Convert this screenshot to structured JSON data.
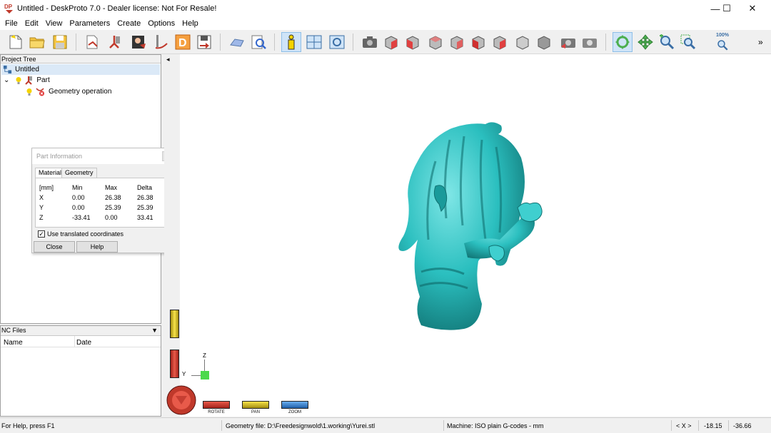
{
  "window": {
    "title": "Untitled - DeskProto 7.0 - Dealer license: Not For Resale!",
    "logo_text": "DP",
    "minimize": "—",
    "maximize": "☐",
    "close": "✕"
  },
  "menu": [
    "File",
    "Edit",
    "View",
    "Parameters",
    "Create",
    "Options",
    "Help"
  ],
  "toolbar": {
    "zoom_level": "100%",
    "more": "»"
  },
  "project_tree": {
    "header": "Project Tree",
    "root": "Untitled",
    "part": "Part",
    "operation": "Geometry operation",
    "expander": "⌄"
  },
  "part_info": {
    "title": "Part Information",
    "tabs": [
      "Material",
      "Geometry"
    ],
    "headers": [
      "[mm]",
      "Min",
      "Max",
      "Delta"
    ],
    "rows": [
      {
        "axis": "X",
        "min": "0.00",
        "max": "26.38",
        "delta": "26.38"
      },
      {
        "axis": "Y",
        "min": "0.00",
        "max": "25.39",
        "delta": "25.39"
      },
      {
        "axis": "Z",
        "min": "-33.41",
        "max": "0.00",
        "delta": "33.41"
      }
    ],
    "checkbox_label": "Use translated coordinates",
    "checkbox_mark": "✓",
    "close_label": "Close",
    "help_label": "Help",
    "more_arrow": "▼"
  },
  "nc_files": {
    "header": "NC Files",
    "dropdown": "▼",
    "columns": [
      "Name",
      "Date"
    ]
  },
  "viewport": {
    "collapse_arrow": "◂",
    "axis_z": "Z",
    "axis_y": "Y",
    "rotate_label": "ROTATE",
    "pan_label": "PAN",
    "zoom_label": "ZOOM",
    "model_color": "#2bbfbf"
  },
  "statusbar": {
    "help": "For Help, press F1",
    "geometry_file": "Geometry file: D:\\Freedesignwold\\1.working\\Yurei.stl",
    "machine": "Machine: ISO plain G-codes - mm",
    "coord_label": "< X >",
    "x": "-18.15",
    "y": "-36.66"
  }
}
